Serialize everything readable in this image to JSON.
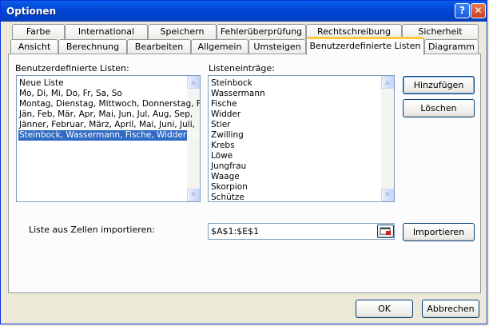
{
  "window": {
    "title": "Optionen",
    "help_glyph": "?",
    "close_glyph": "✕"
  },
  "tabs_back": [
    "Farbe",
    "International",
    "Speichern",
    "Fehlerüberprüfung",
    "Rechtschreibung",
    "Sicherheit"
  ],
  "tabs_front": [
    "Ansicht",
    "Berechnung",
    "Bearbeiten",
    "Allgemein",
    "Umsteigen",
    "Benutzerdefinierte Listen",
    "Diagramm"
  ],
  "active_tab": "Benutzerdefinierte Listen",
  "custom_lists": {
    "label": "Benutzerdefinierte Listen:",
    "items": [
      "Neue Liste",
      "Mo, Di, Mi, Do, Fr, Sa, So",
      "Montag, Dienstag, Mittwoch, Donnerstag, F",
      "Jän, Feb, Mär, Apr, Mai, Jun, Jul, Aug, Sep,",
      "Jänner, Februar, März, April, Mai, Juni, Juli,",
      "Steinbock, Wassermann, Fische, Widder, St"
    ],
    "selected_index": 5
  },
  "entries": {
    "label": "Listeneinträge:",
    "items": [
      "Steinbock",
      "Wassermann",
      "Fische",
      "Widder",
      "Stier",
      "Zwilling",
      "Krebs",
      "Löwe",
      "Jungfrau",
      "Waage",
      "Skorpion",
      "Schütze"
    ]
  },
  "buttons": {
    "add": "Hinzufügen",
    "delete": "Löschen",
    "import": "Importieren",
    "ok": "OK",
    "cancel": "Abbrechen"
  },
  "import": {
    "label": "Liste aus Zellen importieren:",
    "value": "$A$1:$E$1"
  },
  "icons": {
    "scroll_up": "▲",
    "scroll_down": "▼"
  }
}
